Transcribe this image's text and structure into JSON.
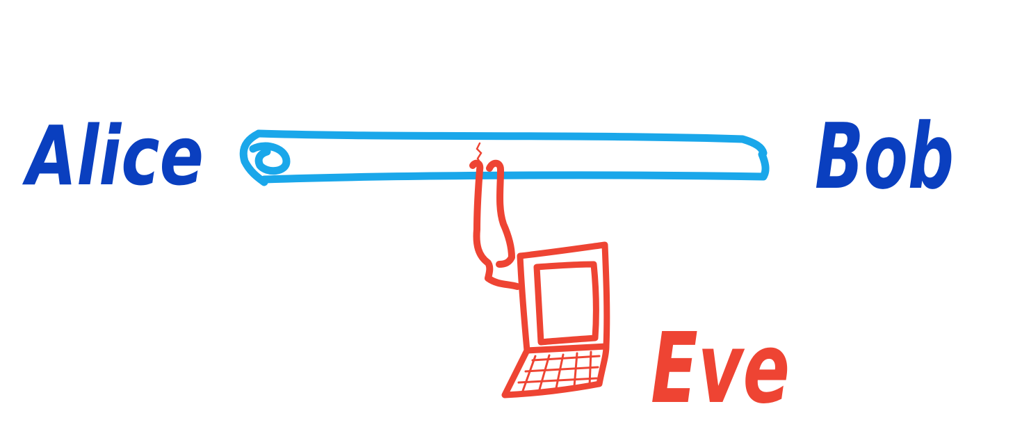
{
  "labels": {
    "alice": "Alice",
    "bob": "Bob",
    "eve": "Eve"
  },
  "colors": {
    "alice_bob_text": "#0a3fbf",
    "channel": "#1aa7ea",
    "eve": "#ee4433",
    "background": "#ffffff"
  },
  "icons": {
    "channel": "pipe-icon",
    "wiretap": "wiretap-cable-icon",
    "computer": "laptop-icon"
  }
}
